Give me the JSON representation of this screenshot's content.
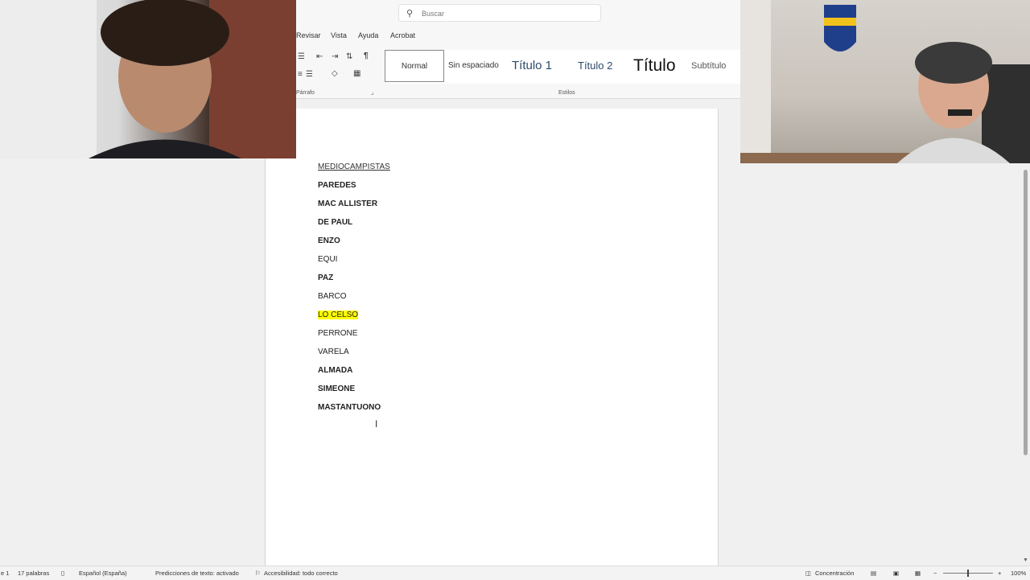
{
  "search": {
    "placeholder": "Buscar"
  },
  "menu": [
    "Revisar",
    "Vista",
    "Ayuda",
    "Acrobat"
  ],
  "ribbon": {
    "paragraph_group_label": "Párrafo",
    "styles_group_label": "Estilos",
    "styles": [
      "Normal",
      "Sin espaciado",
      "Título 1",
      "Título 2",
      "Título",
      "Subtítulo"
    ],
    "pilcrow": "¶"
  },
  "document": {
    "lines": [
      {
        "text": "MEDIOCAMPISTAS",
        "style": "underline"
      },
      {
        "text": "PAREDES",
        "style": "bold"
      },
      {
        "text": "MAC ALLISTER",
        "style": "bold"
      },
      {
        "text": "DE PAUL",
        "style": "bold"
      },
      {
        "text": "ENZO",
        "style": "bold"
      },
      {
        "text": "EQUI",
        "style": "normal"
      },
      {
        "text": "PAZ",
        "style": "bold"
      },
      {
        "text": "BARCO",
        "style": "normal"
      },
      {
        "text": "LO CELSO",
        "style": "highlight"
      },
      {
        "text": "PERRONE",
        "style": "normal"
      },
      {
        "text": "VARELA",
        "style": "normal"
      },
      {
        "text": "ALMADA",
        "style": "bold"
      },
      {
        "text": "SIMEONE",
        "style": "bold"
      },
      {
        "text": "MASTANTUONO",
        "style": "bold"
      }
    ],
    "highlight_color": "#ffff00"
  },
  "statusbar": {
    "page": "e 1",
    "words": "17 palabras",
    "language": "Español (España)",
    "predictions": "Predicciones de texto: activado",
    "accessibility": "Accesibilidad: todo correcto",
    "focus": "Concentración",
    "zoom": "100%"
  }
}
